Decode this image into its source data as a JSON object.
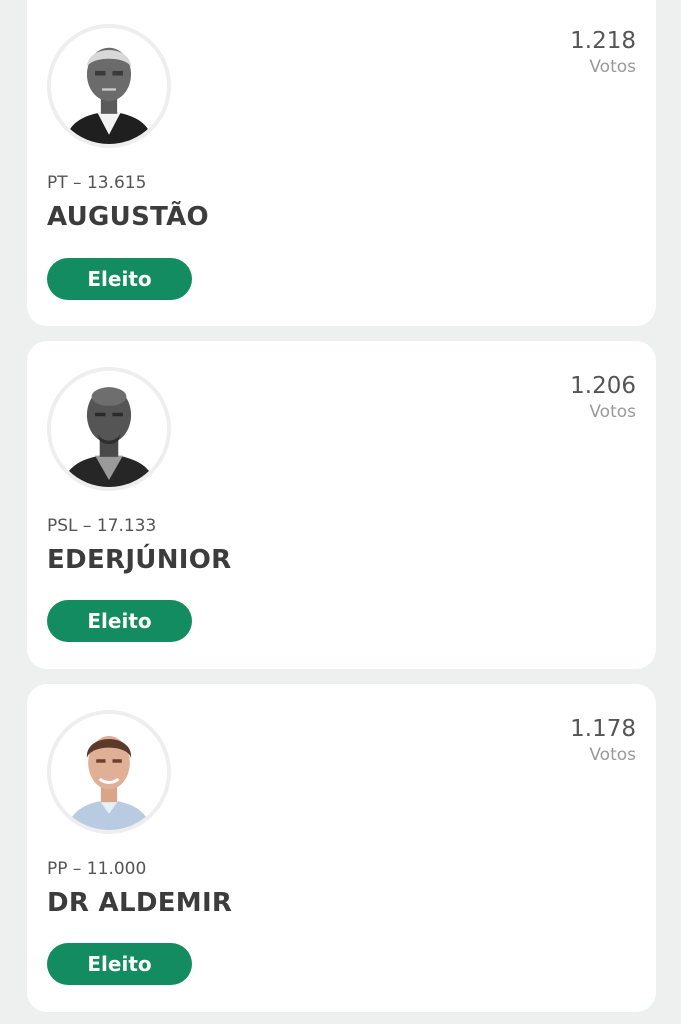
{
  "candidates": [
    {
      "photo": "candidate-photo-augustao",
      "votes": "1.218",
      "votes_label": "Votos",
      "party": "PT – 13.615",
      "name": "AUGUSTÃO",
      "status": "Eleito"
    },
    {
      "photo": "candidate-photo-ederjunior",
      "votes": "1.206",
      "votes_label": "Votos",
      "party": "PSL – 17.133",
      "name": "EDERJÚNIOR",
      "status": "Eleito"
    },
    {
      "photo": "candidate-photo-dr-aldemir",
      "votes": "1.178",
      "votes_label": "Votos",
      "party": "PP – 11.000",
      "name": "DR ALDEMIR",
      "status": "Eleito"
    }
  ],
  "colors": {
    "background": "#eef0f0",
    "card": "#ffffff",
    "elected_badge": "#148c61",
    "name_text": "#3c3c3c",
    "muted_text": "#9a9a9a"
  }
}
